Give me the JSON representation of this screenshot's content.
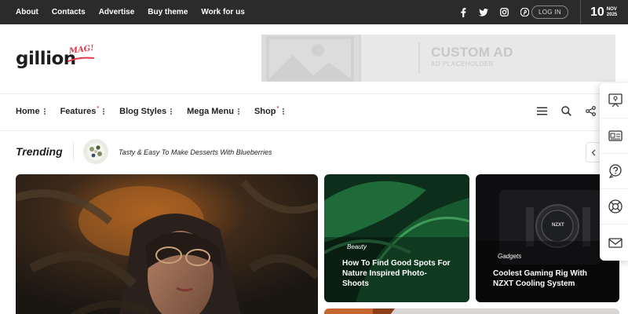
{
  "topbar": {
    "links": [
      "About",
      "Contacts",
      "Advertise",
      "Buy theme",
      "Work for us"
    ],
    "social_icons": [
      "facebook-icon",
      "twitter-icon",
      "instagram-icon",
      "pinterest-icon"
    ],
    "login_label": "LOG IN",
    "date": {
      "day": "10",
      "month": "NOV",
      "year": "2025"
    }
  },
  "header": {
    "logo": {
      "text": "gillion",
      "mark": "MAG!"
    },
    "ad": {
      "title": "CUSTOM AD",
      "subtitle": "AD PLACEHOLDER"
    }
  },
  "mainnav": {
    "items": [
      {
        "label": "Home",
        "star": false
      },
      {
        "label": "Features",
        "star": true
      },
      {
        "label": "Blog Styles",
        "star": false
      },
      {
        "label": "Mega Menu",
        "star": false
      },
      {
        "label": "Shop",
        "star": true
      }
    ],
    "star_glyph": "*",
    "icons": [
      "menu-icon",
      "search-icon",
      "share-icon"
    ]
  },
  "trending": {
    "label": "Trending",
    "headline": "Tasty & Easy To Make Desserts With Blueberries"
  },
  "cards": [
    {
      "category": "",
      "title": ""
    },
    {
      "category": "Beauty",
      "title_lines": [
        "How To Find Good Spots For",
        "Nature Inspired Photo-",
        "Shoots"
      ]
    },
    {
      "category": "Gadgets",
      "title_lines": [
        "Coolest Gaming Rig With",
        "NZXT Cooling System"
      ],
      "device_text": "NZXT"
    }
  ],
  "sidepanel": {
    "icons": [
      "presentation-icon",
      "news-icon",
      "help-icon",
      "lifebuoy-icon",
      "mail-icon"
    ]
  },
  "colors": {
    "accent": "#e63946",
    "topbar": "#2b2b2b"
  }
}
